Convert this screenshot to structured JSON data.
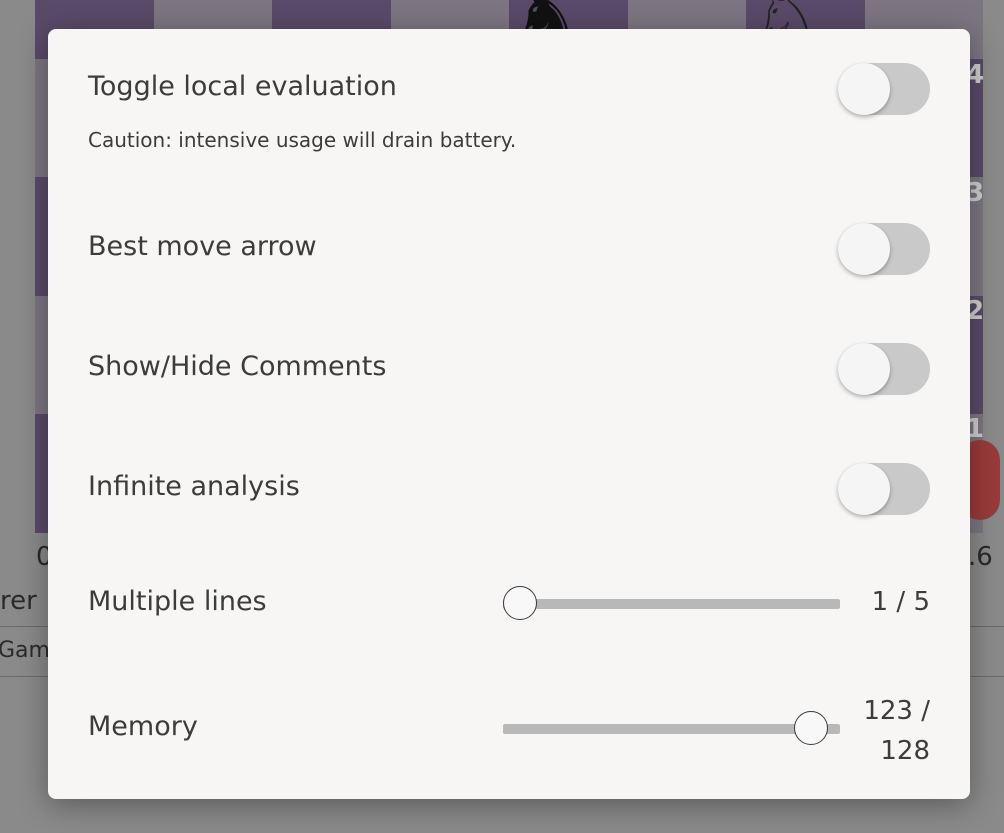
{
  "background": {
    "rank_labels": [
      "4",
      "3",
      "2",
      "1"
    ],
    "left_fragments": [
      "0",
      "rer",
      "Game"
    ],
    "right_fragment": ".6"
  },
  "settings": {
    "local_eval": {
      "label": "Toggle local evaluation",
      "caution": "Caution: intensive usage will drain battery.",
      "enabled": false
    },
    "best_move_arrow": {
      "label": "Best move arrow",
      "enabled": false
    },
    "comments": {
      "label": "Show/Hide Comments",
      "enabled": false
    },
    "infinite_analysis": {
      "label": "Infinite analysis",
      "enabled": false
    },
    "multiple_lines": {
      "label": "Multiple lines",
      "value": 1,
      "max": 5,
      "display": "1 / 5"
    },
    "memory": {
      "label": "Memory",
      "value": 123,
      "max": 128,
      "display_line1": "123 /",
      "display_line2": "128"
    }
  },
  "colors": {
    "modal_bg": "#f7f6f4",
    "toggle_off_track": "#c9c9c9",
    "slider_track": "#b8b8b8",
    "board_dark": "#5a4a6a"
  }
}
